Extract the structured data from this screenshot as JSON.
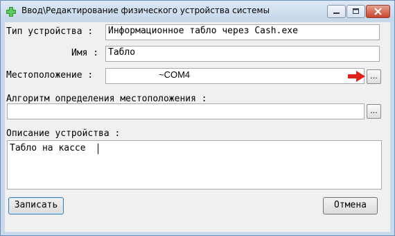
{
  "window": {
    "title": "Ввод\\Редактирование физического устройства системы",
    "controls": [
      "minimize-icon",
      "maximize-icon",
      "close-icon"
    ]
  },
  "form": {
    "device_type": {
      "label": "Тип устройства :",
      "value": "Информационное табло через Cash.exe"
    },
    "name": {
      "label": "Имя :",
      "value": "Табло"
    },
    "location": {
      "label": "Местоположение :",
      "value": "~COM4",
      "browse_label": "..."
    },
    "location_algorithm": {
      "label": "Алгоритм определения местоположения :",
      "value": "",
      "browse_label": "..."
    },
    "description": {
      "label": "Описание устройства :",
      "value": "Табло на кассе"
    }
  },
  "buttons": {
    "save": "Записать",
    "cancel": "Отмена"
  },
  "annotation": {
    "arrow_color": "#e0201b",
    "icon": "red-arrow-icon"
  }
}
